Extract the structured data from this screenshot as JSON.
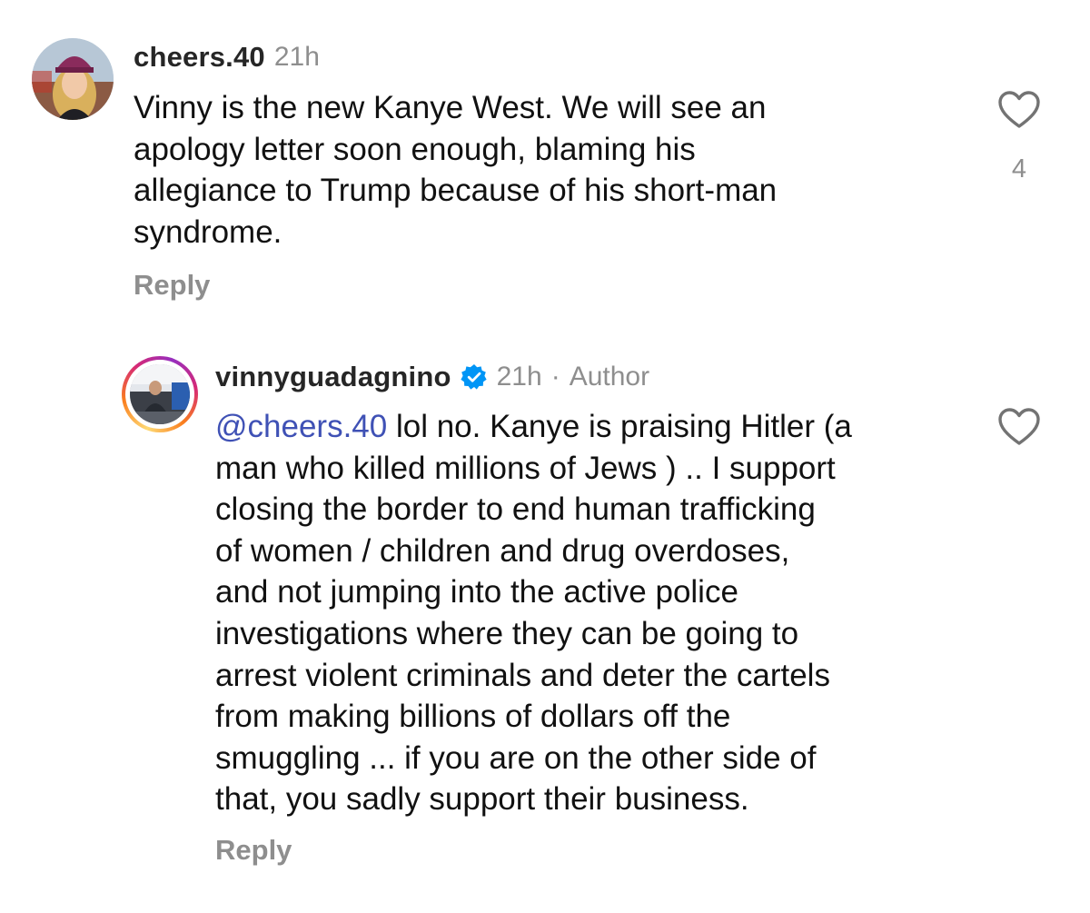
{
  "comments": [
    {
      "username": "cheers.40",
      "time": "21h",
      "text": "Vinny is the new Kanye West. We will see an\napology letter soon enough, blaming his\nallegiance to Trump because of his short-man\nsyndrome.",
      "like_count": "4",
      "reply_label": "Reply"
    },
    {
      "username": "vinnyguadagnino",
      "time": "21h",
      "dot": "·",
      "author_label": "Author",
      "mention": "@cheers.40",
      "text": " lol no. Kanye is praising Hitler (a\nman who killed millions of Jews ) .. I support\nclosing the border to end human trafficking\nof women / children and drug overdoses,\nand not jumping into the active police\ninvestigations where they can be going to\narrest violent criminals and deter the cartels\nfrom making billions of dollars off the\nsmuggling ... if you are on the other side of\nthat, you  sadly support their business.",
      "reply_label": "Reply"
    }
  ],
  "icons": {
    "like": "heart-outline-icon",
    "verified": "verified-badge-icon"
  },
  "colors": {
    "meta_gray": "#8e8e8e",
    "mention_blue": "#3f51b5",
    "verified_blue": "#0095f6"
  }
}
